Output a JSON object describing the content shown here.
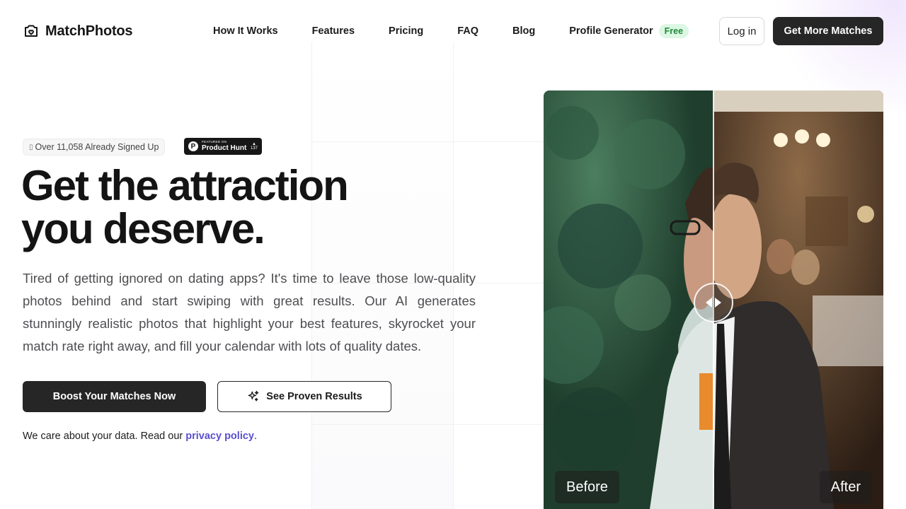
{
  "brand": {
    "name": "MatchPhotos"
  },
  "nav": {
    "items": [
      {
        "label": "How It Works"
      },
      {
        "label": "Features"
      },
      {
        "label": "Pricing"
      },
      {
        "label": "FAQ"
      },
      {
        "label": "Blog"
      },
      {
        "label": "Profile Generator",
        "badge": "Free"
      }
    ],
    "login_label": "Log in",
    "cta_label": "Get More Matches"
  },
  "hero": {
    "signup_badge": "Over 11,058 Already Signed Up",
    "product_hunt": {
      "small": "FEATURED ON",
      "big": "Product Hunt",
      "count": "137"
    },
    "title_line1": "Get the attraction",
    "title_line2": "you deserve.",
    "description": "Tired of getting ignored on dating apps? It's time to leave those low-quality photos behind and start swiping with great results. Our AI generates stunningly realistic photos that highlight your best features, skyrocket your match rate right away, and fill your calendar with lots of quality dates.",
    "primary_button": "Boost Your Matches Now",
    "secondary_button": "See Proven Results",
    "privacy_prefix": "We care about your data. Read our ",
    "privacy_link": "privacy policy",
    "privacy_suffix": "."
  },
  "comparison": {
    "before_label": "Before",
    "after_label": "After"
  },
  "colors": {
    "dark": "#262626",
    "link": "#5a4fcf",
    "badge_green": "#1f8a3a",
    "badge_green_bg": "#dcf7e3"
  },
  "icons": {
    "logo": "camera-heart-icon",
    "sparkle": "sparkles-icon",
    "slider": "slider-arrows-icon"
  }
}
